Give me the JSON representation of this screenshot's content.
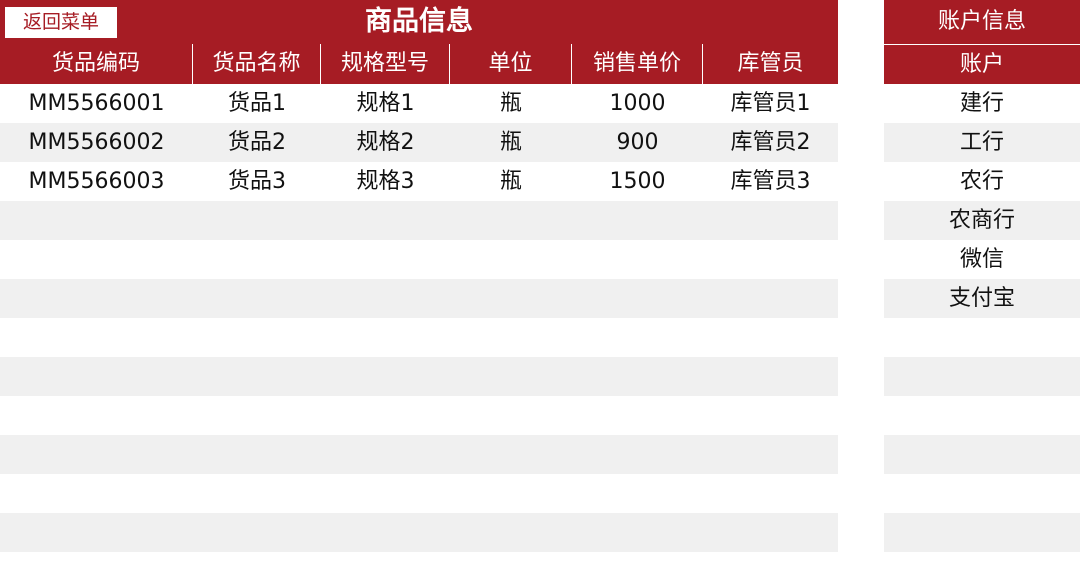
{
  "toolbar": {
    "back_label": "返回菜单"
  },
  "main": {
    "title": "商品信息",
    "columns": [
      "货品编码",
      "货品名称",
      "规格型号",
      "单位",
      "销售单价",
      "库管员"
    ],
    "rows": [
      [
        "MM5566001",
        "货品1",
        "规格1",
        "瓶",
        "1000",
        "库管员1"
      ],
      [
        "MM5566002",
        "货品2",
        "规格2",
        "瓶",
        "900",
        "库管员2"
      ],
      [
        "MM5566003",
        "货品3",
        "规格3",
        "瓶",
        "1500",
        "库管员3"
      ],
      [
        "",
        "",
        "",
        "",
        "",
        ""
      ],
      [
        "",
        "",
        "",
        "",
        "",
        ""
      ],
      [
        "",
        "",
        "",
        "",
        "",
        ""
      ],
      [
        "",
        "",
        "",
        "",
        "",
        ""
      ],
      [
        "",
        "",
        "",
        "",
        "",
        ""
      ],
      [
        "",
        "",
        "",
        "",
        "",
        ""
      ],
      [
        "",
        "",
        "",
        "",
        "",
        ""
      ],
      [
        "",
        "",
        "",
        "",
        "",
        ""
      ],
      [
        "",
        "",
        "",
        "",
        "",
        ""
      ]
    ]
  },
  "account": {
    "title": "账户信息",
    "column": "账户",
    "rows": [
      "建行",
      "工行",
      "农行",
      "农商行",
      "微信",
      "支付宝",
      "",
      "",
      "",
      "",
      "",
      ""
    ]
  },
  "colors": {
    "header_bg": "#A61C24",
    "stripe": "#F0F0F0"
  }
}
